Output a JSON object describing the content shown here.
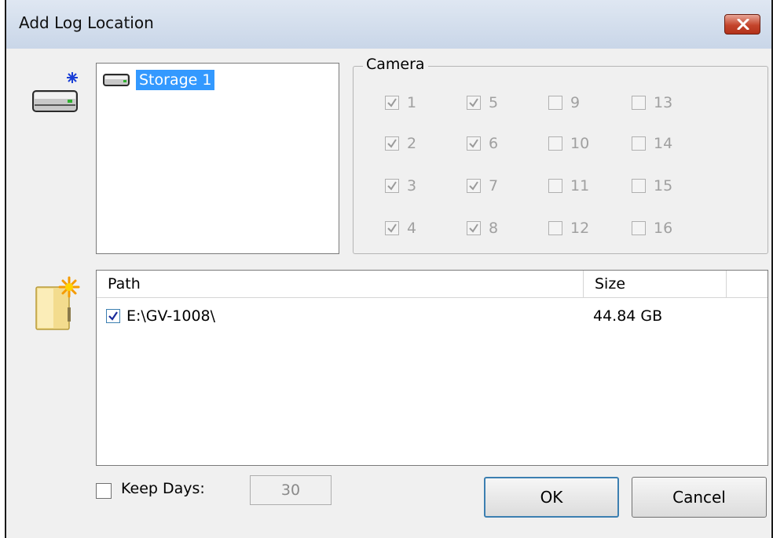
{
  "window": {
    "title": "Add Log Location"
  },
  "storage_tree": {
    "items": [
      {
        "label": "Storage 1",
        "selected": true
      }
    ]
  },
  "camera_group": {
    "label": "Camera",
    "cameras": [
      {
        "label": "1",
        "checked": true
      },
      {
        "label": "2",
        "checked": true
      },
      {
        "label": "3",
        "checked": true
      },
      {
        "label": "4",
        "checked": true
      },
      {
        "label": "5",
        "checked": true
      },
      {
        "label": "6",
        "checked": true
      },
      {
        "label": "7",
        "checked": true
      },
      {
        "label": "8",
        "checked": true
      },
      {
        "label": "9",
        "checked": false
      },
      {
        "label": "10",
        "checked": false
      },
      {
        "label": "11",
        "checked": false
      },
      {
        "label": "12",
        "checked": false
      },
      {
        "label": "13",
        "checked": false
      },
      {
        "label": "14",
        "checked": false
      },
      {
        "label": "15",
        "checked": false
      },
      {
        "label": "16",
        "checked": false
      }
    ],
    "enabled": false
  },
  "path_list": {
    "columns": {
      "path": "Path",
      "size": "Size"
    },
    "rows": [
      {
        "checked": true,
        "path": "E:\\GV-1008\\",
        "size": "44.84 GB"
      }
    ]
  },
  "keep_days": {
    "label": "Keep Days:",
    "checked": false,
    "value": "30"
  },
  "buttons": {
    "ok": "OK",
    "cancel": "Cancel"
  },
  "icons": {
    "add_storage": "add-storage-icon",
    "add_folder": "add-folder-icon",
    "storage_node": "drive-icon",
    "close": "close-icon"
  },
  "colors": {
    "selection": "#3399ff",
    "close_button": "#c4452c",
    "title_bar": "#c9d6e8"
  }
}
